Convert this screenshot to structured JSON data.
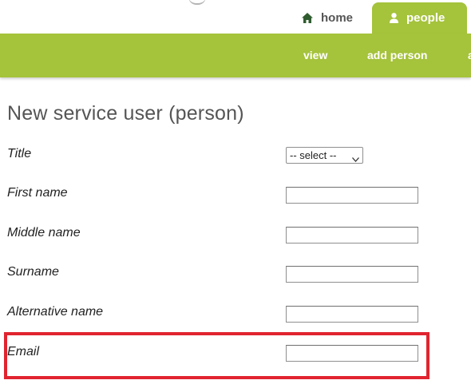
{
  "tabs": [
    {
      "label": "home",
      "icon": "home-icon"
    },
    {
      "label": "people",
      "icon": "person-icon"
    }
  ],
  "nav": {
    "links": [
      "view",
      "add person"
    ]
  },
  "page": {
    "title": "New service user (person)"
  },
  "form": {
    "title_label": "Title",
    "title_select_value": "-- select --",
    "first_name_label": "First name",
    "middle_name_label": "Middle name",
    "surname_label": "Surname",
    "alternative_name_label": "Alternative name",
    "email_label": "Email"
  },
  "colors": {
    "brand_green": "#a5c33b",
    "highlight_red": "#e0242f"
  }
}
